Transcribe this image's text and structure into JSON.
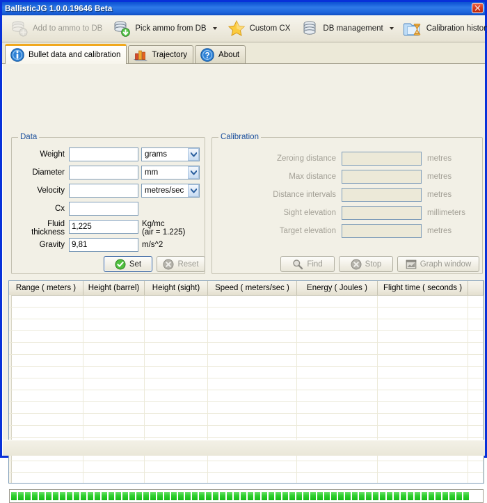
{
  "window": {
    "title": "BallisticJG  1.0.0.19646  Beta",
    "close_label": "Close",
    "accent_titlebar": "#0e56d2",
    "accent_tab_active": "#f0a81e"
  },
  "toolbar": {
    "items": [
      {
        "label": "Add to ammo to DB",
        "icon": "database-add-icon",
        "disabled": true,
        "has_caret": false
      },
      {
        "label": "Pick ammo from DB",
        "icon": "database-download-icon",
        "disabled": false,
        "has_caret": true
      },
      {
        "label": "Custom CX",
        "icon": "star-icon",
        "disabled": false,
        "has_caret": false
      },
      {
        "label": "DB management",
        "icon": "database-icon",
        "disabled": false,
        "has_caret": true
      },
      {
        "label": "Calibration history",
        "icon": "folder-hourglass-icon",
        "disabled": false,
        "has_caret": false
      }
    ]
  },
  "tabs": [
    {
      "label": "Bullet data and calibration",
      "icon": "info-icon",
      "active": true
    },
    {
      "label": "Trajectory",
      "icon": "bar-chart-icon",
      "active": false
    },
    {
      "label": "About",
      "icon": "question-icon",
      "active": false
    }
  ],
  "data_group": {
    "title": "Data",
    "fields": [
      {
        "label": "Weight",
        "value": "",
        "unit_type": "combo",
        "unit": "grams"
      },
      {
        "label": "Diameter",
        "value": "",
        "unit_type": "combo",
        "unit": "mm"
      },
      {
        "label": "Velocity",
        "value": "",
        "unit_type": "combo",
        "unit": "metres/sec"
      },
      {
        "label": "Cx",
        "value": "",
        "unit_type": "none",
        "unit": ""
      },
      {
        "label": "Fluid\nthickness",
        "value": "1,225",
        "unit_type": "text",
        "unit": "Kg/mc\n(air = 1.225)"
      },
      {
        "label": "Gravity",
        "value": "9,81",
        "unit_type": "text",
        "unit": "m/s^2"
      }
    ],
    "set_label": "Set",
    "reset_label": "Reset"
  },
  "calibration_group": {
    "title": "Calibration",
    "fields": [
      {
        "label": "Zeroing distance",
        "value": "",
        "unit": "metres"
      },
      {
        "label": "Max distance",
        "value": "",
        "unit": "metres"
      },
      {
        "label": "Distance intervals",
        "value": "",
        "unit": "metres"
      },
      {
        "label": "Sight elevation",
        "value": "",
        "unit": "millimeters"
      },
      {
        "label": "Target elevation",
        "value": "",
        "unit": "metres"
      }
    ],
    "find_label": "Find",
    "stop_label": "Stop",
    "graph_label": "Graph window"
  },
  "grid": {
    "columns": [
      {
        "label": "Range ( meters )",
        "width": 107
      },
      {
        "label": "Height (barrel)",
        "width": 88
      },
      {
        "label": "Height (sight)",
        "width": 91
      },
      {
        "label": "Speed ( meters/sec )",
        "width": 128
      },
      {
        "label": "Energy ( Joules )",
        "width": 116
      },
      {
        "label": "Flight time ( seconds )",
        "width": 130
      },
      {
        "label": "",
        "width": 22
      }
    ],
    "rows": [],
    "empty_row_count": 16
  },
  "progress": {
    "value_percent": 100,
    "segment_count": 66,
    "color": "#2fcf2f"
  }
}
